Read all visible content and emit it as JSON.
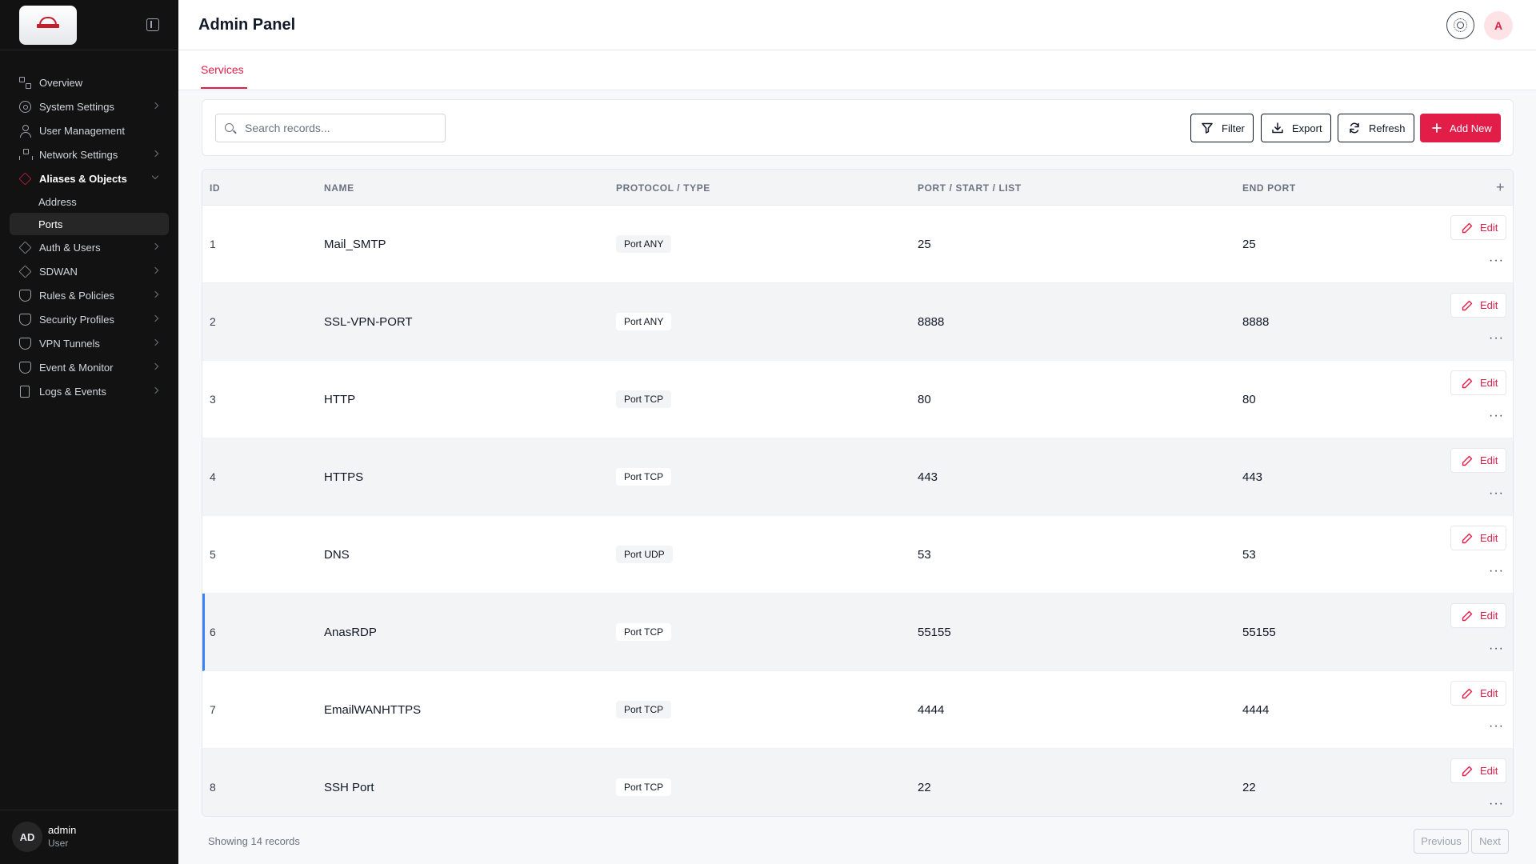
{
  "header": {
    "title": "Admin Panel",
    "avatar_initial": "A"
  },
  "sidebar": {
    "items": [
      {
        "label": "Overview",
        "icon": "grid-icon"
      },
      {
        "label": "System Settings",
        "icon": "gear-icon"
      },
      {
        "label": "User Management",
        "icon": "user-icon"
      },
      {
        "label": "Network Settings",
        "icon": "network-icon"
      },
      {
        "label": "Aliases & Objects",
        "icon": "cube-icon"
      },
      {
        "label": "Auth & Users",
        "icon": "cube-icon"
      },
      {
        "label": "SDWAN",
        "icon": "cube-icon"
      },
      {
        "label": "Rules & Policies",
        "icon": "shield-icon"
      },
      {
        "label": "Security Profiles",
        "icon": "shield-icon"
      },
      {
        "label": "VPN Tunnels",
        "icon": "shield-icon"
      },
      {
        "label": "Event & Monitor",
        "icon": "shield-icon"
      },
      {
        "label": "Logs & Events",
        "icon": "document-icon"
      }
    ],
    "sub_items": [
      {
        "label": "Address"
      },
      {
        "label": "Ports"
      }
    ],
    "user": {
      "initials": "AD",
      "name": "admin",
      "role": "User"
    }
  },
  "tabs": [
    {
      "label": "Services"
    }
  ],
  "toolbar": {
    "search_placeholder": "Search records...",
    "filter_label": "Filter",
    "export_label": "Export",
    "refresh_label": "Refresh",
    "add_label": "Add New"
  },
  "table": {
    "columns": [
      "ID",
      "NAME",
      "PROTOCOL / TYPE",
      "PORT / START / LIST",
      "END PORT"
    ],
    "edit_label": "Edit",
    "more_label": "···",
    "rows": [
      {
        "id": "1",
        "name": "Mail_SMTP",
        "protocol": "Port ANY",
        "port": "25",
        "end_port": "25"
      },
      {
        "id": "2",
        "name": "SSL-VPN-PORT",
        "protocol": "Port ANY",
        "port": "8888",
        "end_port": "8888"
      },
      {
        "id": "3",
        "name": "HTTP",
        "protocol": "Port TCP",
        "port": "80",
        "end_port": "80"
      },
      {
        "id": "4",
        "name": "HTTPS",
        "protocol": "Port TCP",
        "port": "443",
        "end_port": "443"
      },
      {
        "id": "5",
        "name": "DNS",
        "protocol": "Port UDP",
        "port": "53",
        "end_port": "53"
      },
      {
        "id": "6",
        "name": "AnasRDP",
        "protocol": "Port TCP",
        "port": "55155",
        "end_port": "55155"
      },
      {
        "id": "7",
        "name": "EmailWANHTTPS",
        "protocol": "Port TCP",
        "port": "4444",
        "end_port": "4444"
      },
      {
        "id": "8",
        "name": "SSH Port",
        "protocol": "Port TCP",
        "port": "22",
        "end_port": "22"
      }
    ]
  },
  "footer": {
    "records_text": "Showing 14 records",
    "previous_label": "Previous",
    "next_label": "Next"
  },
  "colors": {
    "accent": "#e11d48",
    "sidebar_bg": "#121212",
    "highlight": "#3b82f6"
  }
}
